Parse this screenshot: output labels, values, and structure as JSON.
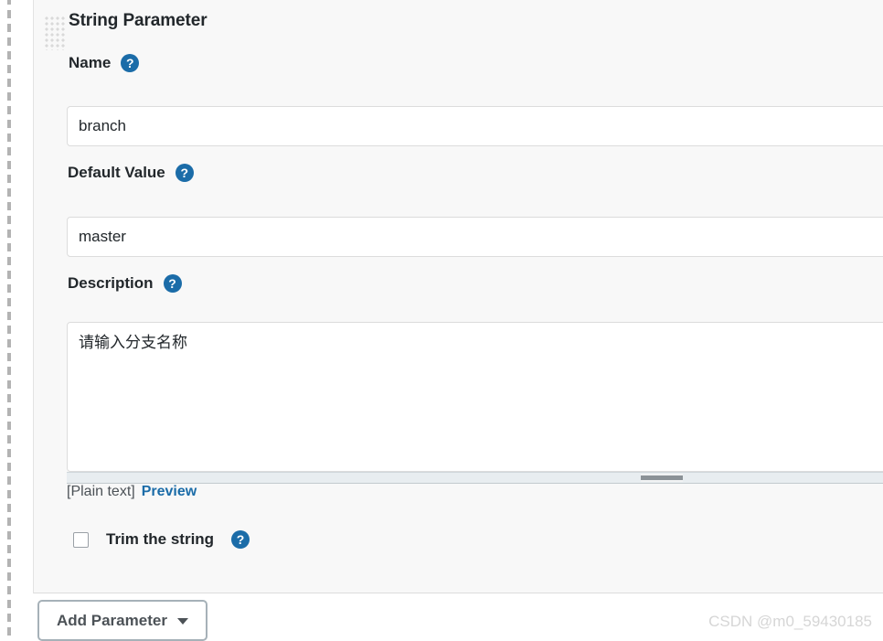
{
  "panel": {
    "title": "String Parameter",
    "drag_handle_name": "drag-handle-dots"
  },
  "fields": {
    "name": {
      "label": "Name",
      "value": "branch",
      "placeholder": "",
      "help_glyph": "?"
    },
    "default_value": {
      "label": "Default Value",
      "value": "master",
      "placeholder": "",
      "help_glyph": "?"
    },
    "description": {
      "label": "Description",
      "value": "请输入分支名称",
      "placeholder": "",
      "help_glyph": "?"
    }
  },
  "markup_row": {
    "format_label": "[Plain text]",
    "preview_link": "Preview"
  },
  "trim": {
    "label": "Trim the string",
    "checked": false,
    "help_glyph": "?"
  },
  "footer": {
    "add_parameter_label": "Add Parameter",
    "caret_icon": "chevron-down-icon"
  },
  "watermark": {
    "text": "CSDN @m0_59430185"
  },
  "colors": {
    "help_blue": "#1b6ca8",
    "link_blue": "#1b6ca8",
    "panel_bg": "#f8f8f8",
    "text": "#22272b",
    "border": "#dcdcdc",
    "button_border": "#a6b1b8",
    "watermark": "#d6d6d6"
  }
}
